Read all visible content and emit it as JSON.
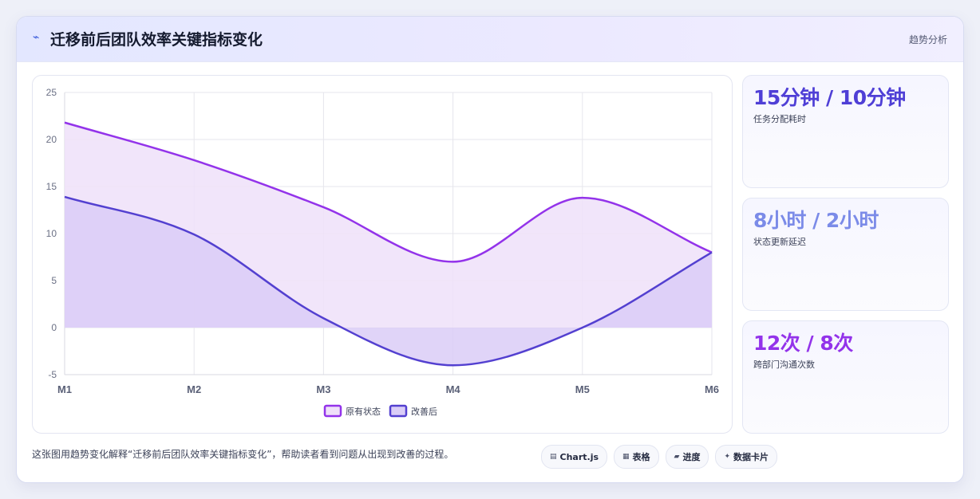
{
  "header": {
    "icon": "lightning-icon",
    "title": "迁移前后团队效率关键指标变化",
    "tag": "趋势分析"
  },
  "chart_data": {
    "type": "area",
    "categories": [
      "M1",
      "M2",
      "M3",
      "M4",
      "M5",
      "M6"
    ],
    "series": [
      {
        "name": "原有状态",
        "values": [
          21.8,
          17.8,
          12.8,
          7,
          13.8,
          8
        ],
        "color": "#9333ea",
        "fill": "#efe0f9"
      },
      {
        "name": "改善后",
        "values": [
          13.9,
          9.9,
          1,
          -4,
          0,
          8
        ],
        "color": "#5340d0",
        "fill": "#dacdf7"
      }
    ],
    "ylim": [
      -5,
      25
    ],
    "yticks": [
      25,
      20,
      15,
      10,
      5,
      0,
      -5
    ],
    "grid": true,
    "legend": "bottom"
  },
  "stats": [
    {
      "value": "15分钟 / 10分钟",
      "label": "任务分配耗时",
      "color": "#4f3fd6"
    },
    {
      "value": "8小时 / 2小时",
      "label": "状态更新延迟",
      "color": "#7b8be8"
    },
    {
      "value": "12次 / 8次",
      "label": "跨部门沟通次数",
      "color": "#9333ea"
    }
  ],
  "footer": {
    "text": "这张图用趋势变化解释“迁移前后团队效率关键指标变化”，帮助读者看到问题从出现到改善的过程。",
    "chips": [
      {
        "icon": "chart-icon",
        "glyph": "▤",
        "label": "Chart.js"
      },
      {
        "icon": "table-icon",
        "glyph": "▦",
        "label": "表格"
      },
      {
        "icon": "progress-icon",
        "glyph": "▰",
        "label": "进度"
      },
      {
        "icon": "card-icon",
        "glyph": "✦",
        "label": "数据卡片"
      }
    ]
  }
}
